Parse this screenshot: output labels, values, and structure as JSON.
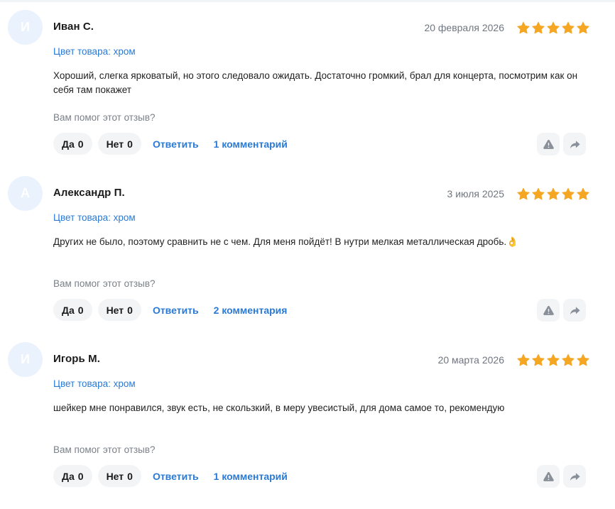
{
  "helpful_prompt": "Вам помог этот отзыв?",
  "labels": {
    "yes": "Да",
    "no": "Нет",
    "reply": "Ответить"
  },
  "colors": {
    "accent": "#2a7ad5",
    "star": "#f5a623",
    "avatar_bg": "#e9f2fd",
    "pill_bg": "#f3f4f6",
    "muted_text": "#7a8088"
  },
  "icons": {
    "star": "star-icon",
    "report": "warning-triangle-icon",
    "share": "share-arrow-icon"
  },
  "reviews": [
    {
      "avatar_letter": "И",
      "author": "Иван С.",
      "date": "20 февраля 2026",
      "rating": 5,
      "variant": "Цвет товара: хром",
      "text": "Хороший, слегка ярковатый, но этого следовало ожидать. Достаточно громкий, брал для концерта, посмотрим как он себя там покажет",
      "yes_count": "0",
      "no_count": "0",
      "comments": "1 комментарий"
    },
    {
      "avatar_letter": "А",
      "author": "Александр П.",
      "date": "3 июля 2025",
      "rating": 5,
      "variant": "Цвет товара: хром",
      "text": "Других не было, поэтому сравнить не с чем. Для меня пойдёт! В нутри мелкая металлическая дробь.👌",
      "yes_count": "0",
      "no_count": "0",
      "comments": "2 комментария"
    },
    {
      "avatar_letter": "И",
      "author": "Игорь М.",
      "date": "20 марта 2026",
      "rating": 5,
      "variant": "Цвет товара: хром",
      "text": "шейкер мне понравился, звук есть, не скользкий, в меру увесистый, для дома самое то, рекомендую",
      "yes_count": "0",
      "no_count": "0",
      "comments": "1 комментарий"
    }
  ]
}
